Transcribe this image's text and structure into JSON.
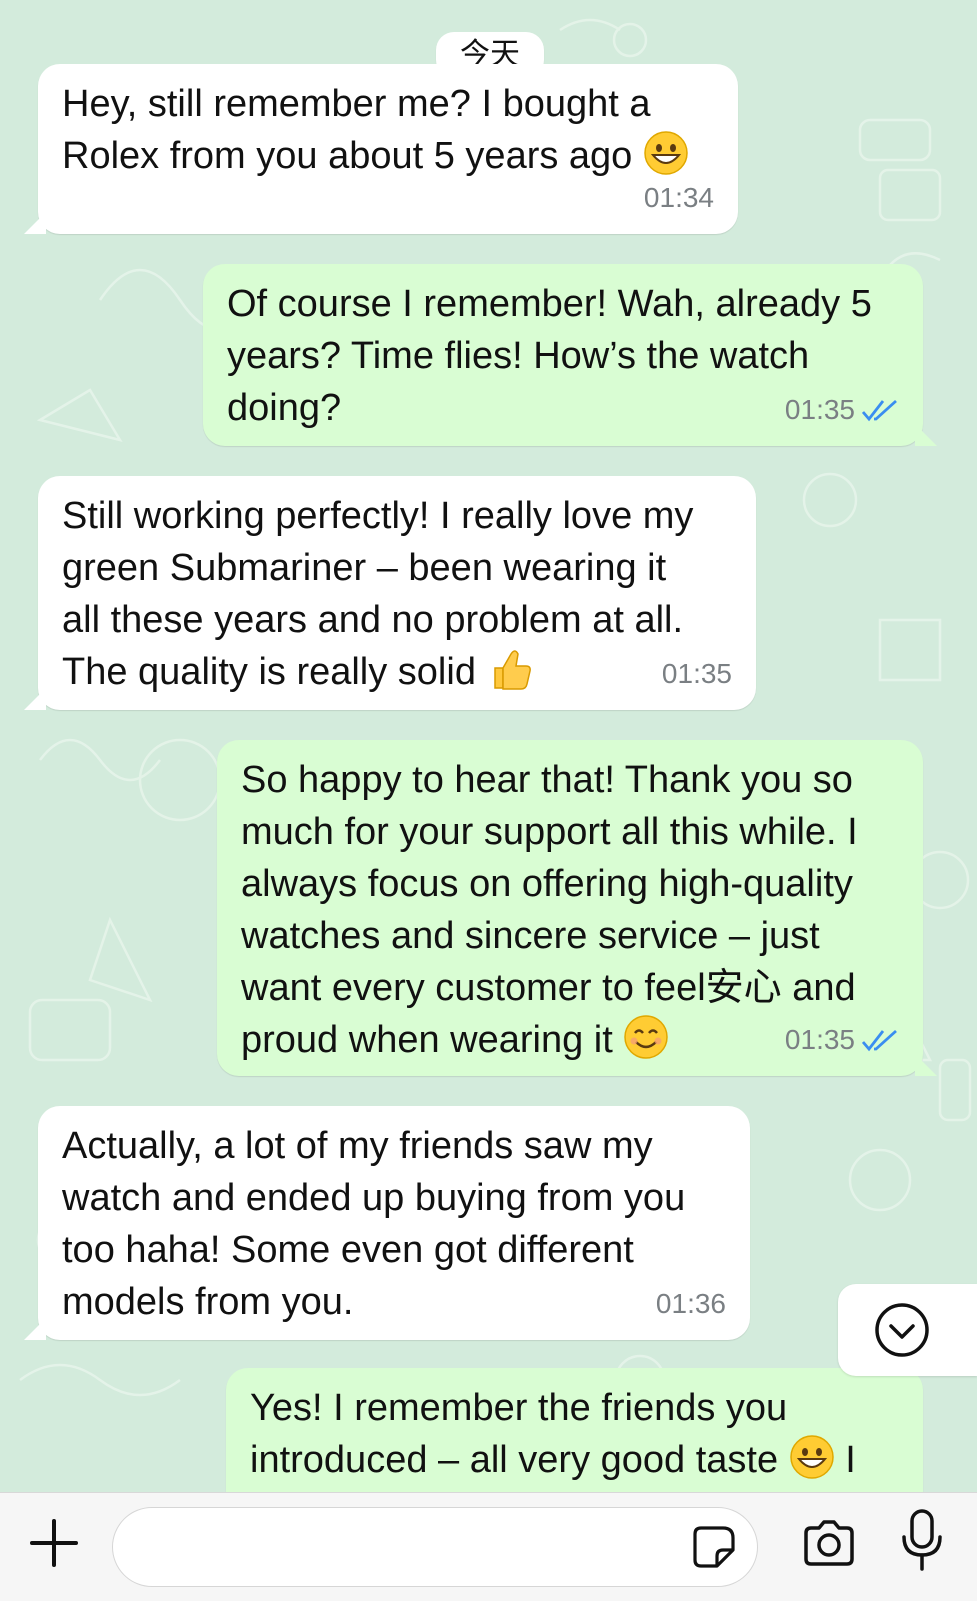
{
  "date_separator": "今天",
  "messages": [
    {
      "direction": "incoming",
      "lines": [
        "Hey, still remember me? I bought a",
        "Rolex from you about 5 years ago"
      ],
      "emoji": "grinning-face",
      "time": "01:34"
    },
    {
      "direction": "outgoing",
      "lines": [
        "Of course I remember! Wah, already 5",
        "years? Time flies! How’s the watch",
        "doing?"
      ],
      "time": "01:35",
      "status": "read"
    },
    {
      "direction": "incoming",
      "lines": [
        "Still working perfectly! I really love my",
        "green Submariner – been wearing it",
        "all these years and no problem at all.",
        "The quality is really solid"
      ],
      "emoji": "thumbs-up",
      "time": "01:35"
    },
    {
      "direction": "outgoing",
      "lines": [
        "So happy to hear that! Thank you so",
        "much for your support all this while. I",
        "always focus on offering high-quality",
        "watches and sincere service – just",
        "want every customer to feel安心 and",
        "proud when wearing it"
      ],
      "emoji": "smiling-face",
      "time": "01:35",
      "status": "read"
    },
    {
      "direction": "incoming",
      "lines": [
        "Actually, a lot of my friends saw my",
        "watch and ended up buying from you",
        "too haha! Some even got different",
        "models from you."
      ],
      "time": "01:36"
    },
    {
      "direction": "outgoing",
      "lines": [
        "Yes! I remember the friends you",
        "introduced – all very good taste"
      ],
      "emoji": "grinning-face",
      "trailing": "I",
      "partial": true
    }
  ],
  "colors": {
    "chat_background": "#d3ebdc",
    "incoming_bubble": "#ffffff",
    "outgoing_bubble": "#d9fdd3",
    "read_ticks": "#3a8ef0",
    "timestamp": "#7a7f83"
  },
  "icons": {
    "scroll_down": "chevron-down-circle-icon",
    "attach": "plus-icon",
    "sticker": "sticker-icon",
    "camera": "camera-icon",
    "microphone": "microphone-icon"
  }
}
